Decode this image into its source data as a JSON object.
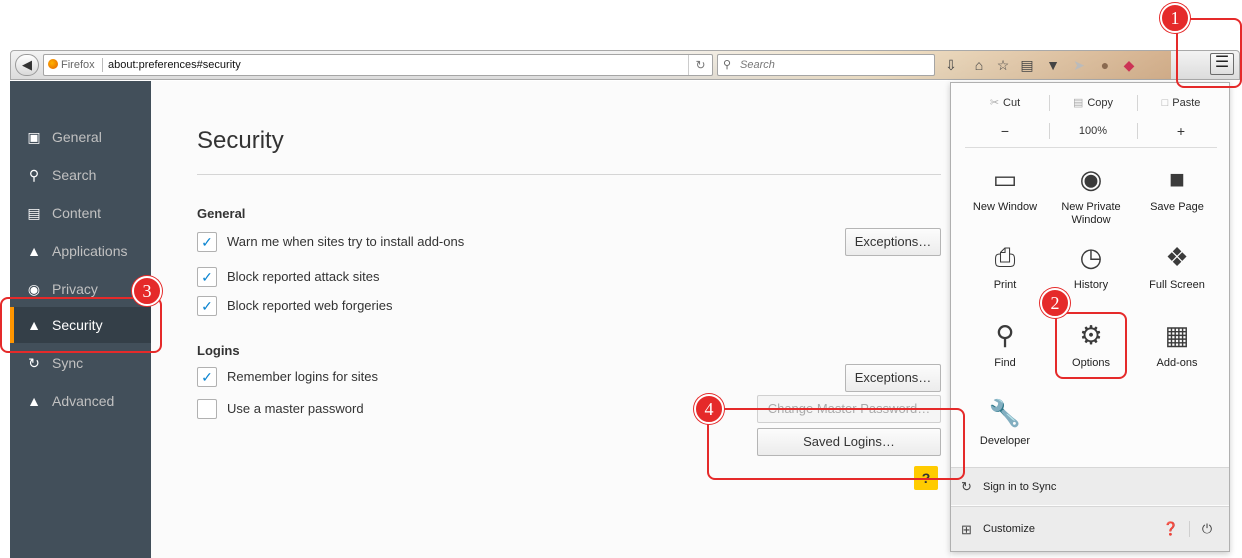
{
  "browser": {
    "identity_label": "Firefox",
    "url": "about:preferences#security",
    "search_placeholder": "Search",
    "reload_icon": "reload-icon",
    "menu_icon": "hamburger-menu-icon"
  },
  "sidebar": {
    "items": [
      {
        "label": "General",
        "icon": "general-icon"
      },
      {
        "label": "Search",
        "icon": "search-icon"
      },
      {
        "label": "Content",
        "icon": "content-icon"
      },
      {
        "label": "Applications",
        "icon": "applications-icon"
      },
      {
        "label": "Privacy",
        "icon": "privacy-mask-icon"
      },
      {
        "label": "Security",
        "icon": "security-lock-icon",
        "active": true
      },
      {
        "label": "Sync",
        "icon": "sync-icon"
      },
      {
        "label": "Advanced",
        "icon": "advanced-icon"
      }
    ],
    "active_color": "#ff9500"
  },
  "main": {
    "title": "Security",
    "general": {
      "heading": "General",
      "warn_addons": "Warn me when sites try to install add-ons",
      "warn_addons_checked": true,
      "block_attack": "Block reported attack sites",
      "block_attack_checked": true,
      "block_forgeries": "Block reported web forgeries",
      "block_forgeries_checked": true,
      "exceptions_label": "Exceptions…"
    },
    "logins": {
      "heading": "Logins",
      "remember": "Remember logins for sites",
      "remember_checked": true,
      "master": "Use a master password",
      "master_checked": false,
      "exceptions_label": "Exceptions…",
      "change_master_label": "Change Master Password…",
      "saved_logins_label": "Saved Logins…"
    },
    "help_label": "?"
  },
  "panel": {
    "edit": {
      "cut": "Cut",
      "copy": "Copy",
      "paste": "Paste"
    },
    "zoom": {
      "minus": "−",
      "level": "100%",
      "plus": "+"
    },
    "items": [
      {
        "label": "New Window",
        "icon": "new-window-icon"
      },
      {
        "label": "New Private Window",
        "icon": "private-mask-icon"
      },
      {
        "label": "Save Page",
        "icon": "save-page-icon"
      },
      {
        "label": "Print",
        "icon": "print-icon"
      },
      {
        "label": "History",
        "icon": "history-clock-icon"
      },
      {
        "label": "Full Screen",
        "icon": "full-screen-icon"
      },
      {
        "label": "Find",
        "icon": "find-magnifier-icon"
      },
      {
        "label": "Options",
        "icon": "options-gear-icon"
      },
      {
        "label": "Add-ons",
        "icon": "addons-puzzle-icon"
      },
      {
        "label": "Developer",
        "icon": "developer-wrench-icon"
      }
    ],
    "sign_in": "Sign in to Sync",
    "customize": "Customize"
  },
  "callouts": {
    "color": "#e52a2a",
    "labels": [
      "1",
      "2",
      "3",
      "4"
    ]
  }
}
